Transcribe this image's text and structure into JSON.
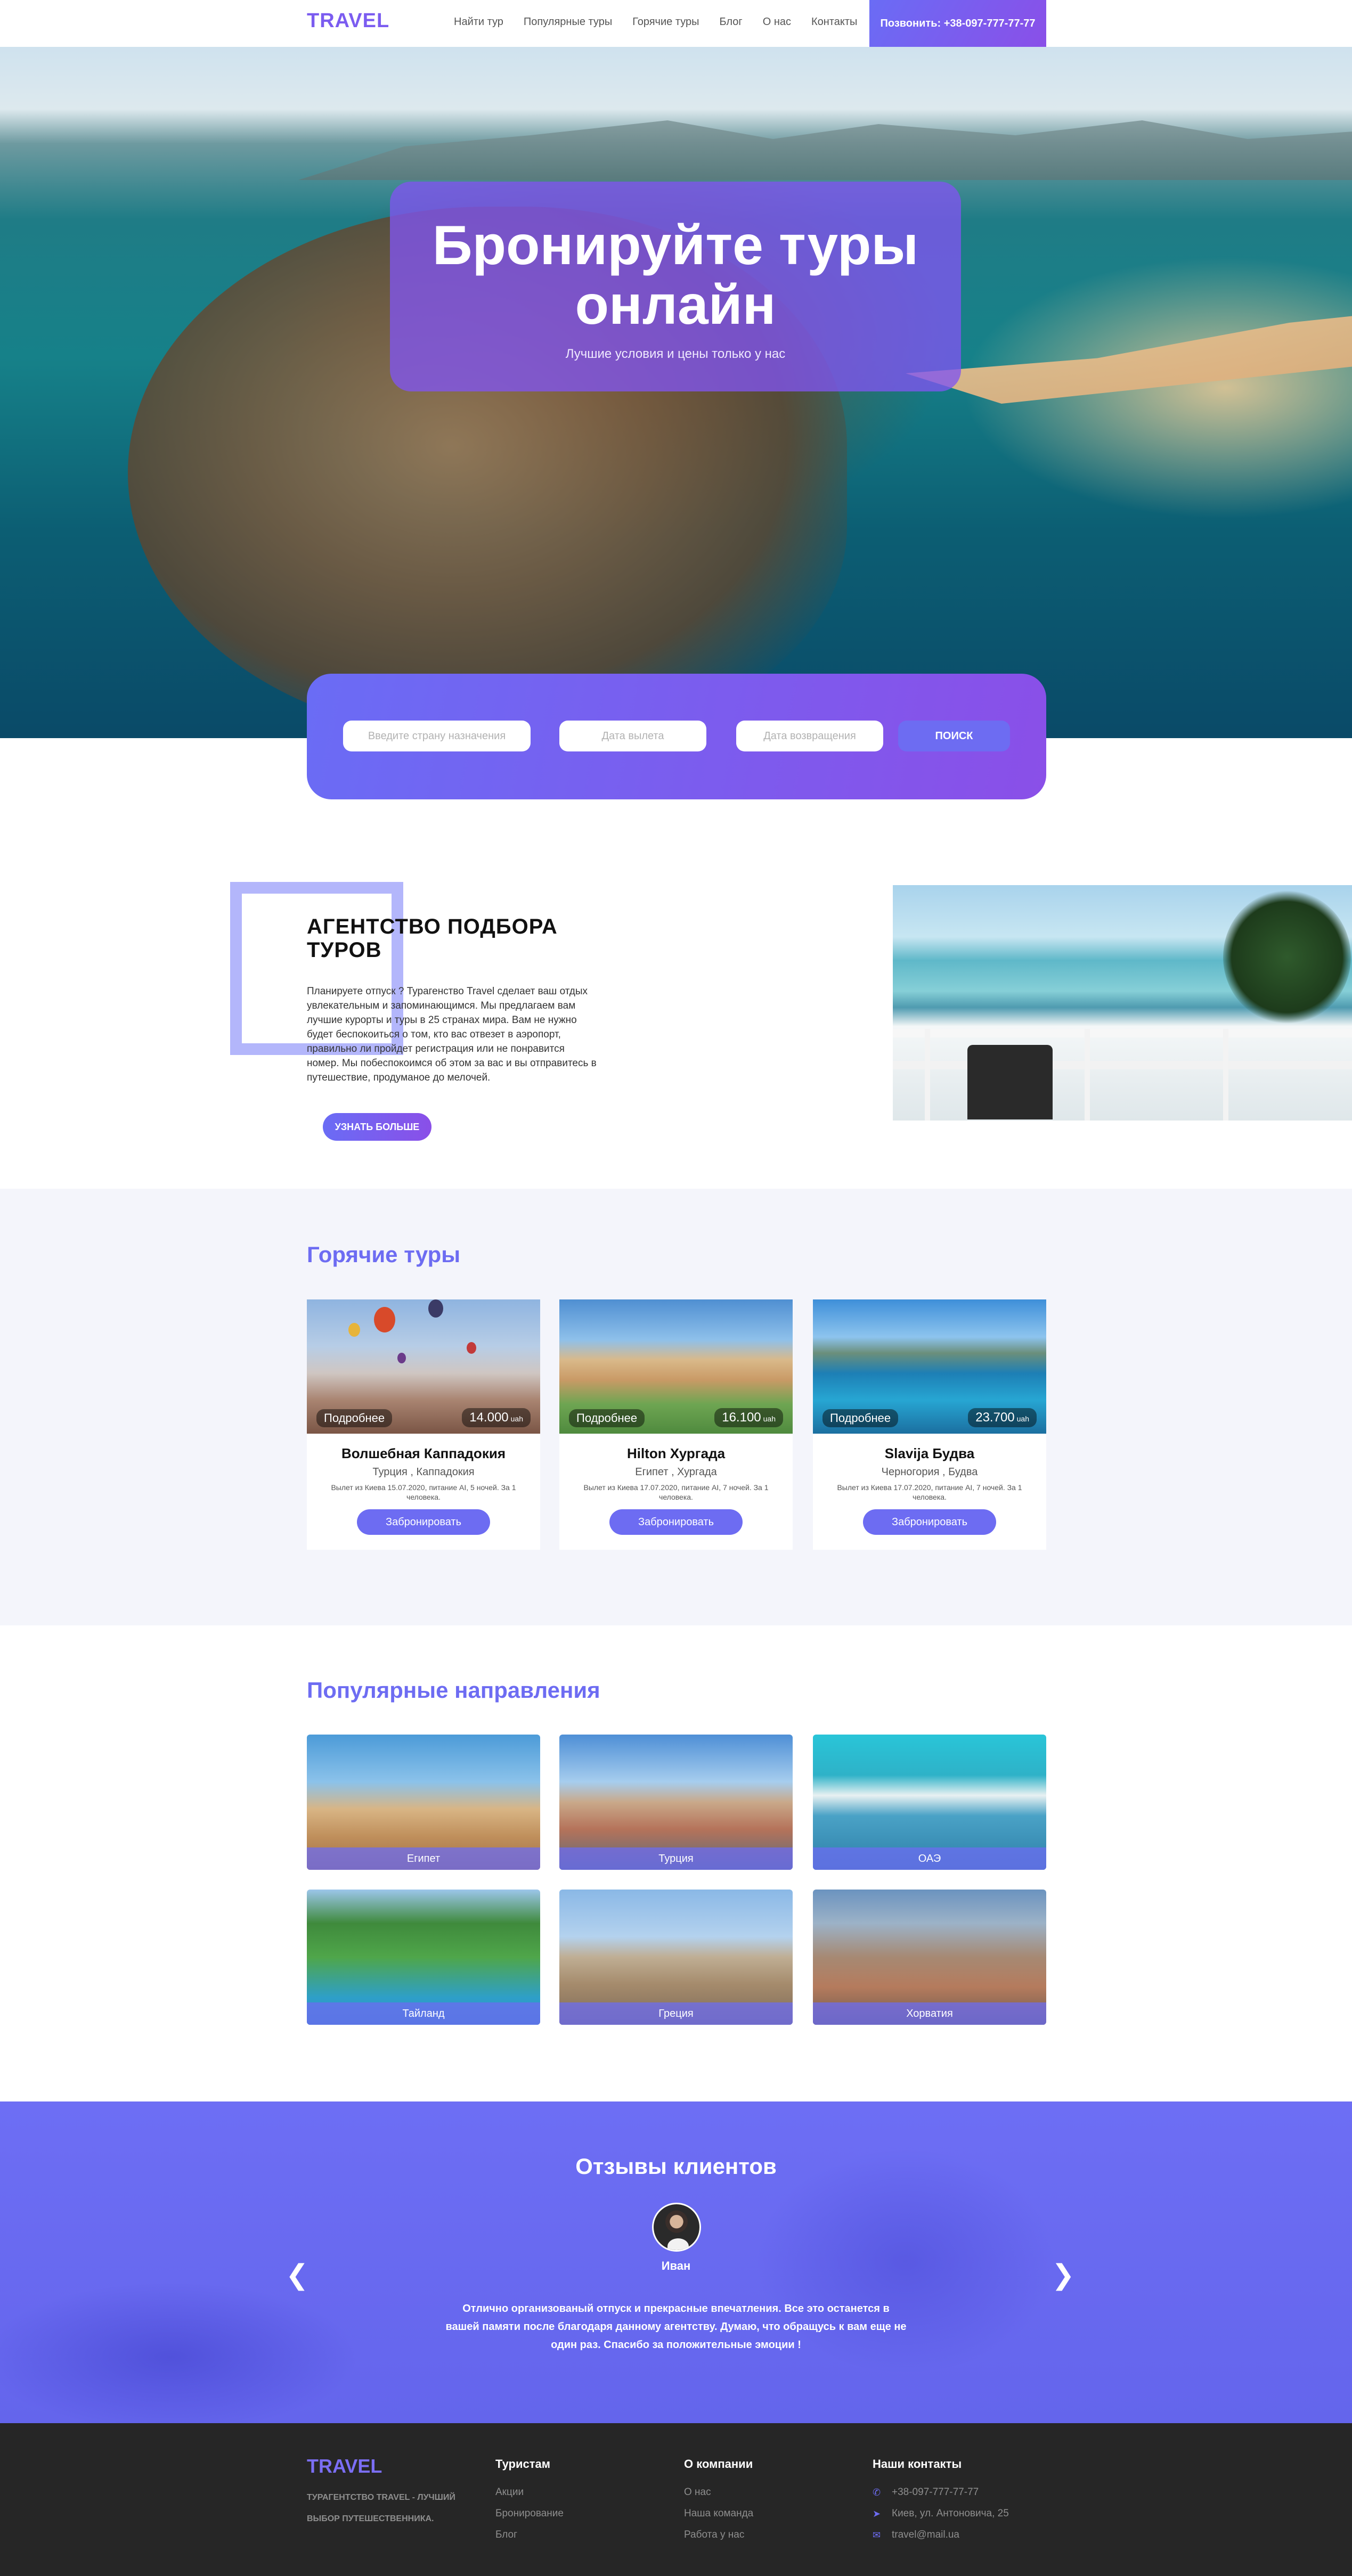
{
  "header": {
    "logo": "TRAVEL",
    "nav": [
      "Найти тур",
      "Популярные туры",
      "Горячие туры",
      "Блог",
      "О нас",
      "Контакты"
    ],
    "call_button": "Позвонить: +38-097-777-77-77"
  },
  "hero": {
    "title_line1": "Бронируйте туры",
    "title_line2": "онлайн",
    "subtitle": "Лучшие условия и цены только у нас"
  },
  "search": {
    "destination_placeholder": "Введите страну назначения",
    "departure_placeholder": "Дата вылета",
    "return_placeholder": "Дата возвращения",
    "button": "ПОИСК"
  },
  "about": {
    "title": "АГЕНТСТВО ПОДБОРА ТУРОВ",
    "text": "Планируете отпуск ? Турагенство Travel сделает ваш отдых увлекательным и запоминающимся. Мы предлагаем вам лучшие курорты и туры в 25 странах мира. Вам не нужно будет беспокоиться о том, кто вас отвезет в аэропорт, правильно ли пройдет регистрация или не понравится номер. Мы побеспокоимся об этом за вас и вы отправитесь в путешествие, продуманое до мелочей.",
    "button": "УЗНАТЬ БОЛЬШЕ"
  },
  "hot_tours": {
    "title": "Горячие туры",
    "more_label": "Подробнее",
    "currency": "uah",
    "book_label": "Забронировать",
    "tours": [
      {
        "name": "Волшебная Каппадокия",
        "location": "Турция , Каппадокия",
        "price": "14.000",
        "desc": "Вылет из Киева 15.07.2020, питание AI, 5 ночей. За 1 человека."
      },
      {
        "name": "Hilton Хургада",
        "location": "Египет , Хургада",
        "price": "16.100",
        "desc": "Вылет из Киева 17.07.2020, питание AI, 7 ночей. За 1 человека."
      },
      {
        "name": "Slavija Будва",
        "location": "Черногория , Будва",
        "price": "23.700",
        "desc": "Вылет из Киева 17.07.2020, питание AI, 7 ночей. За 1 человека."
      }
    ]
  },
  "destinations": {
    "title": "Популярные направления",
    "items": [
      "Египет",
      "Турция",
      "ОАЭ",
      "Тайланд",
      "Греция",
      "Хорватия"
    ]
  },
  "reviews": {
    "title": "Отзывы клиентов",
    "name": "Иван",
    "text": "Отлично организованый отпуск и прекрасные впечатления. Все это останется в вашей памяти после благодаря данному агентству. Думаю, что обращусь к вам еще не один раз. Спасибо за положительные эмоции !",
    "prev_icon": "chevron-left-icon",
    "next_icon": "chevron-right-icon"
  },
  "footer": {
    "logo": "TRAVEL",
    "slogan": "ТУРАГЕНТСТВО TRAVEL - ЛУЧШИЙ ВЫБОР ПУТЕШЕСТВЕННИКА.",
    "tourists": {
      "title": "Туристам",
      "links": [
        "Акции",
        "Бронирование",
        "Блог"
      ]
    },
    "company": {
      "title": "О компании",
      "links": [
        "О нас",
        "Наша команда",
        "Работа у нас"
      ]
    },
    "contacts": {
      "title": "Наши контакты",
      "phone": "+38-097-777-77-77",
      "address": "Киев, ул. Антоновича, 25",
      "email": "travel@mail.ua"
    }
  },
  "colors": {
    "accent": "#6d6cf2",
    "accent_purple": "#8a4fe8",
    "footer_bg": "#262626",
    "hot_bg": "#f4f5fb"
  }
}
